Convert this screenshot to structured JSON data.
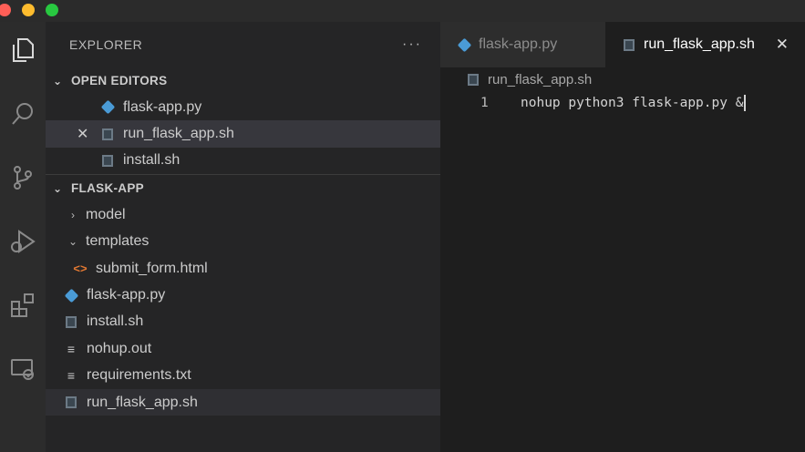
{
  "explorer": {
    "title": "EXPLORER",
    "more": "···",
    "open_editors_label": "OPEN EDITORS",
    "open_editors": [
      {
        "name": "flask-app.py",
        "type": "py"
      },
      {
        "name": "run_flask_app.sh",
        "type": "sh"
      },
      {
        "name": "install.sh",
        "type": "sh"
      }
    ],
    "folder_label": "FLASK-APP",
    "tree": [
      {
        "name": "model",
        "type": "folder-closed"
      },
      {
        "name": "templates",
        "type": "folder-open"
      },
      {
        "name": "submit_form.html",
        "type": "html"
      },
      {
        "name": "flask-app.py",
        "type": "py"
      },
      {
        "name": "install.sh",
        "type": "sh"
      },
      {
        "name": "nohup.out",
        "type": "txt"
      },
      {
        "name": "requirements.txt",
        "type": "txt"
      },
      {
        "name": "run_flask_app.sh",
        "type": "sh"
      }
    ]
  },
  "tabs": [
    {
      "label": "flask-app.py",
      "active": false
    },
    {
      "label": "run_flask_app.sh",
      "active": true,
      "close": "✕"
    }
  ],
  "breadcrumb": "run_flask_app.sh",
  "editor": {
    "line_number": "1",
    "code": "nohup python3 flask-app.py &"
  },
  "icons": {
    "activity": [
      "files-icon",
      "search-icon",
      "source-control-icon",
      "run-debug-icon",
      "extensions-icon",
      "remote-explorer-icon"
    ]
  },
  "colors": {
    "python": "#4a9bd6",
    "html": "#e37933",
    "selected_row": "#37373d"
  }
}
